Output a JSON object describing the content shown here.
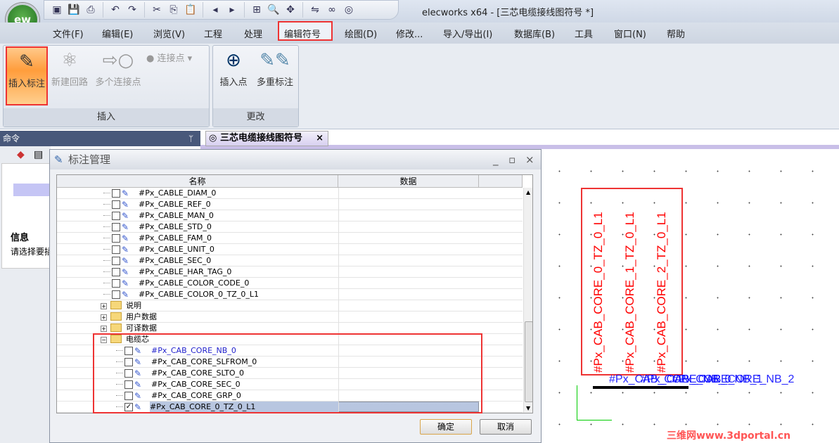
{
  "app": {
    "title": "elecworks x64 - [三芯电缆接线图符号 *]",
    "logo": "ew"
  },
  "qat": [
    "new-icon",
    "save-icon",
    "print-icon",
    "undo-icon",
    "redo-icon",
    "cut-icon",
    "copy-icon",
    "paste-icon",
    "prev-icon",
    "next-icon",
    "zoom-window-icon",
    "zoom-icon",
    "pan-icon",
    "flip-icon",
    "binoculars-icon",
    "symbol-icon"
  ],
  "menu": [
    "文件(F)",
    "编辑(E)",
    "浏览(V)",
    "工程",
    "处理",
    "编辑符号",
    "绘图(D)",
    "修改...",
    "导入/导出(I)",
    "数据库(B)",
    "工具",
    "窗口(N)",
    "帮助"
  ],
  "ribbon": {
    "insert_group": {
      "label": "插入",
      "buttons": [
        "插入标注",
        "新建回路",
        "多个连接点"
      ],
      "dropdown": "连接点"
    },
    "modify_group": {
      "label": "更改",
      "buttons": [
        "插入点",
        "多重标注"
      ]
    }
  },
  "command_panel": {
    "title": "命令",
    "pin": "ᛘ",
    "info_title": "信息",
    "info_text": "请选择要插"
  },
  "doc_tab": {
    "label": "三芯电缆接线图符号",
    "close": "×"
  },
  "dialog": {
    "title": "标注管理",
    "columns": [
      "名称",
      "数据"
    ],
    "cable_items": [
      "#Px_CABLE_DIAM_0",
      "#Px_CABLE_REF_0",
      "#Px_CABLE_MAN_0",
      "#Px_CABLE_STD_0",
      "#Px_CABLE_FAM_0",
      "#Px_CABLE_UNIT_0",
      "#Px_CABLE_SEC_0",
      "#Px_CABLE_HAR_TAG_0",
      "#Px_CABLE_COLOR_CODE_0",
      "#Px_CABLE_COLOR_0_TZ_0_L1"
    ],
    "folders": [
      "说明",
      "用户数据",
      "可译数据",
      "电缆芯"
    ],
    "core_items": [
      {
        "label": "#Px_CAB_CORE_NB_0",
        "checked": false,
        "blue": true
      },
      {
        "label": "#Px_CAB_CORE_SLFROM_0",
        "checked": false
      },
      {
        "label": "#Px_CAB_CORE_SLTO_0",
        "checked": false
      },
      {
        "label": "#Px_CAB_CORE_SEC_0",
        "checked": false
      },
      {
        "label": "#Px_CAB_CORE_GRP_0",
        "checked": false
      },
      {
        "label": "#Px_CAB_CORE_0_TZ_0_L1",
        "checked": true,
        "selected": true
      }
    ],
    "ok": "确定",
    "cancel": "取消"
  },
  "canvas": {
    "vertical_labels": [
      "#Px_CAB_CORE_0_TZ_0_L1",
      "#Px_CAB_CORE_1_TZ_0_L1",
      "#Px_CAB_CORE_2_TZ_0_L1"
    ],
    "overlap_labels": [
      "#Px_CAB_CORE_NB_0",
      "#Px_CAB_CORE_NB_1",
      "#Px_CAB_CORE_NB_2"
    ],
    "label_color": "#ff0000",
    "overlap_color": "#0000ff"
  },
  "watermark": "三维网www.3dportal.cn",
  "colors": {
    "highlight": "#ee3333",
    "accent": "#ff9d3c"
  }
}
